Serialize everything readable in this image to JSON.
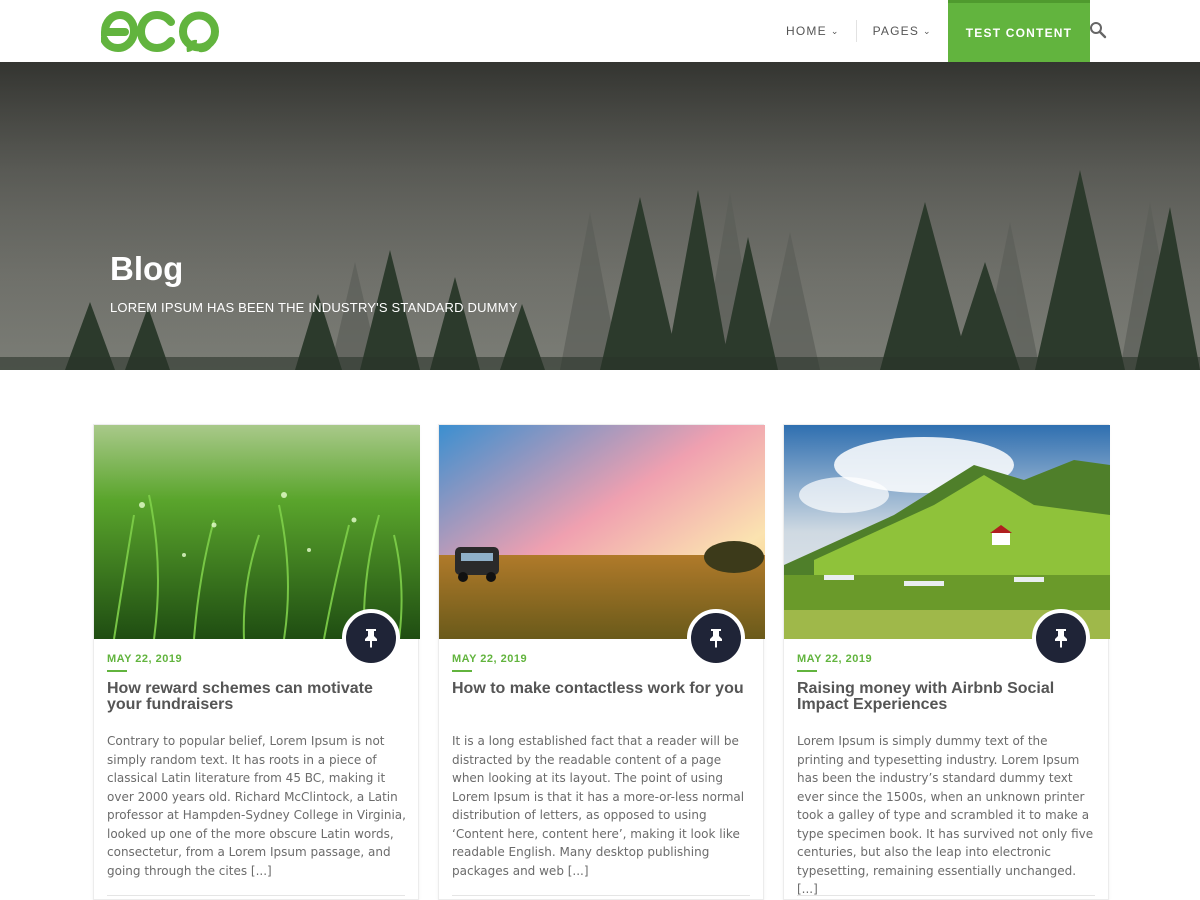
{
  "brand": {
    "logo_text": "eco",
    "accent": "#62b43e",
    "dark": "#1f2437"
  },
  "nav": {
    "items": [
      {
        "label": "HOME",
        "has_dropdown": true
      },
      {
        "label": "PAGES",
        "has_dropdown": true
      },
      {
        "label": "TEST CONTENT",
        "active": true
      }
    ],
    "search_icon": "search-icon"
  },
  "hero": {
    "title": "Blog",
    "subtitle": "LOREM IPSUM HAS BEEN THE INDUSTRY'S STANDARD DUMMY"
  },
  "posts": [
    {
      "date": "MAY 22, 2019",
      "title": "How reward schemes can motivate your fundraisers",
      "excerpt": "Contrary to popular belief, Lorem Ipsum is not simply random text. It has roots in a piece of classical Latin literature from 45 BC, making it over 2000 years old. Richard McClintock, a Latin professor at Hampden-Sydney College in Virginia, looked up one of the more obscure Latin words, consectetur, from a Lorem Ipsum passage, and going through the cites [...]",
      "icon": "pin-icon"
    },
    {
      "date": "MAY 22, 2019",
      "title": "How to make contactless work for you",
      "excerpt": "It is a long established fact that a reader will be distracted by the readable content of a page when looking at its layout. The point of using Lorem Ipsum is that it has a more-or-less normal distribution of letters, as opposed to using ‘Content here, content here’, making it look like readable English. Many desktop publishing packages and web [...]",
      "icon": "pin-icon"
    },
    {
      "date": "MAY 22, 2019",
      "title": "Raising money with Airbnb Social Impact Experiences",
      "excerpt": "Lorem Ipsum is simply dummy text of the printing and typesetting industry. Lorem Ipsum has been the industry’s standard dummy text ever since the 1500s, when an unknown printer took a galley of type and scrambled it to make a type specimen book. It has survived not only five centuries, but also the leap into electronic typesetting, remaining essentially unchanged. [...]",
      "icon": "pin-icon"
    }
  ]
}
